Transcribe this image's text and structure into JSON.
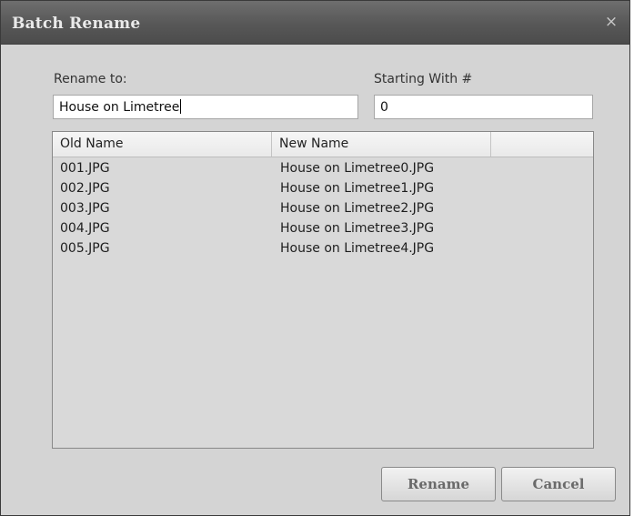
{
  "window": {
    "title": "Batch Rename",
    "close_glyph": "×"
  },
  "form": {
    "rename_label": "Rename to:",
    "rename_value": "House on Limetree",
    "start_label": "Starting With #",
    "start_value": "0"
  },
  "table": {
    "columns": [
      "Old Name",
      "New Name",
      ""
    ],
    "rows": [
      {
        "old": "001.JPG",
        "new": "House on Limetree0.JPG"
      },
      {
        "old": "002.JPG",
        "new": "House on Limetree1.JPG"
      },
      {
        "old": "003.JPG",
        "new": "House on Limetree2.JPG"
      },
      {
        "old": "004.JPG",
        "new": "House on Limetree3.JPG"
      },
      {
        "old": "005.JPG",
        "new": "House on Limetree4.JPG"
      }
    ]
  },
  "buttons": {
    "rename": "Rename",
    "cancel": "Cancel"
  }
}
